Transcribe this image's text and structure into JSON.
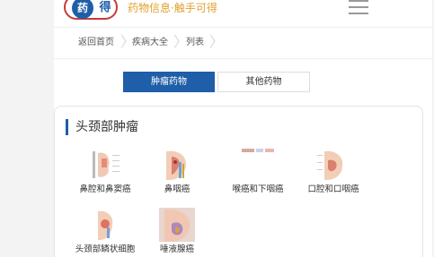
{
  "header": {
    "logo_char_1": "药",
    "logo_char_2": "得",
    "slogan": "药物信息·触手可得"
  },
  "breadcrumb": [
    {
      "label": "返回首页"
    },
    {
      "label": "疾病大全"
    },
    {
      "label": "列表"
    }
  ],
  "tabs": [
    {
      "label": "肿瘤药物",
      "active": true
    },
    {
      "label": "其他药物",
      "active": false
    }
  ],
  "section": {
    "title": "头颈部肿瘤",
    "items": [
      {
        "label": "鼻腔和鼻窦癌"
      },
      {
        "label": "鼻咽癌"
      },
      {
        "label": "喉癌和下咽癌"
      },
      {
        "label": "口腔和口咽癌"
      },
      {
        "label": "头颈部鳞状细胞"
      },
      {
        "label": "唾液腺癌"
      }
    ]
  },
  "colors": {
    "brand_blue": "#1f5ea8",
    "logo_red": "#c63b3b",
    "slogan_orange": "#e0a12e"
  },
  "icons": {
    "menu": "hamburger-menu-icon",
    "breadcrumb_separator": "chevron-right-icon"
  }
}
